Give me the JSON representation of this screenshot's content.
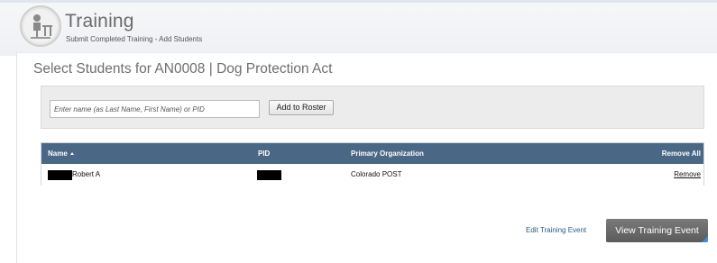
{
  "header": {
    "title": "Training",
    "subtitle": "Submit Completed Training - Add Students",
    "logo_icon": "trainer-at-desk-icon"
  },
  "page": {
    "heading": "Select Students for AN0008 | Dog Protection Act"
  },
  "search": {
    "placeholder": "Enter name (as Last Name, First Name) or PID",
    "add_button_label": "Add to Roster"
  },
  "table": {
    "columns": {
      "name": "Name",
      "pid": "PID",
      "org": "Primary Organization",
      "remove_all": "Remove All"
    },
    "sort_indicator": "sort-ascending-icon",
    "header_color": "#4a6785",
    "rows": [
      {
        "name": "Robert A",
        "org": "Colorado POST",
        "remove": "Remove"
      }
    ]
  },
  "actions": {
    "edit_link": "Edit Training Event",
    "view_button": "View Training Event",
    "view_button_accent": "#3d8fd6"
  }
}
